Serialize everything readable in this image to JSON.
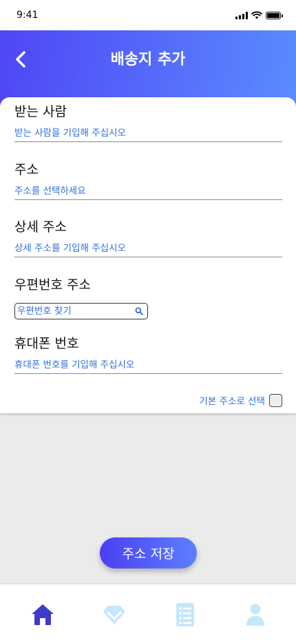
{
  "status_bar": {
    "time": "9:41"
  },
  "header": {
    "title": "배송지 추가"
  },
  "form": {
    "recipient": {
      "label": "받는 사람",
      "placeholder": "받는 사람을 기입해 주십시오"
    },
    "address": {
      "label": "주소",
      "placeholder": "주소를 선택하세요"
    },
    "detail_address": {
      "label": "상세 주소",
      "placeholder": "상세 주소를 기입해 주십시오"
    },
    "zip_code": {
      "label": "우편번호 주소",
      "placeholder": "우편번호 찾기"
    },
    "phone": {
      "label": "휴대폰 번호",
      "placeholder": "휴대폰 번호를 기입해 주십시오"
    },
    "default_address": {
      "label": "기본 주소로 선택",
      "checked": false
    }
  },
  "save_button": {
    "label": "주소 저장"
  },
  "bottom_nav": {
    "items": [
      {
        "icon": "home-icon",
        "active": true
      },
      {
        "icon": "gem-icon",
        "active": false
      },
      {
        "icon": "list-icon",
        "active": false
      },
      {
        "icon": "user-icon",
        "active": false
      }
    ]
  },
  "colors": {
    "accent": "#4f46f5",
    "accent_end": "#5a8cff",
    "link_text": "#2e6fd8",
    "nav_active": "#3d3cc8",
    "nav_inactive": "#c6e6fb",
    "background": "#ebebeb"
  }
}
